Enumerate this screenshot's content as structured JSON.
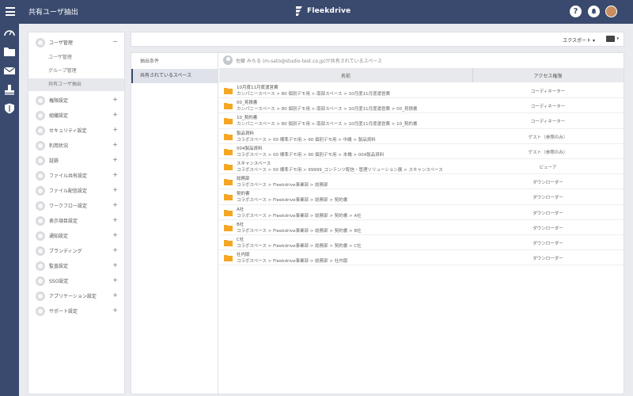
{
  "app": {
    "page_title": "共有ユーザ抽出",
    "brand_name": "Fleekdrive",
    "help_icon_label": "?"
  },
  "sidebar": {
    "items": [
      {
        "label": "ユーザ管理",
        "toggle": "−",
        "subitems": [
          {
            "label": "ユーザ管理"
          },
          {
            "label": "グループ管理"
          },
          {
            "label": "共有ユーザ抽出"
          }
        ]
      },
      {
        "label": "権限設定",
        "toggle": "+"
      },
      {
        "label": "組織設定",
        "toggle": "+"
      },
      {
        "label": "セキュリティ設定",
        "toggle": "+"
      },
      {
        "label": "利用状況",
        "toggle": "+"
      },
      {
        "label": "証跡",
        "toggle": "+"
      },
      {
        "label": "ファイル共有設定",
        "toggle": "+"
      },
      {
        "label": "ファイル配信設定",
        "toggle": "+"
      },
      {
        "label": "ワークフロー設定",
        "toggle": "+"
      },
      {
        "label": "表示項目設定",
        "toggle": "+"
      },
      {
        "label": "通知設定",
        "toggle": "+"
      },
      {
        "label": "ブランディング",
        "toggle": "+"
      },
      {
        "label": "監査設定",
        "toggle": "+"
      },
      {
        "label": "SSO設定",
        "toggle": "+"
      },
      {
        "label": "アプリケーション設定",
        "toggle": "+"
      },
      {
        "label": "サポート設定",
        "toggle": "+"
      }
    ]
  },
  "toolbar": {
    "export_label": "エクスポート ▾",
    "folder_menu_caret": "▾"
  },
  "conditions": {
    "items": [
      {
        "label": "抽出条件"
      },
      {
        "label": "共有されているスペース"
      }
    ]
  },
  "owner": {
    "text": "佐藤 みちる (m-sato@studio-test.co.jp)が共有されているスペース"
  },
  "table": {
    "headers": {
      "name": "名前",
      "access": "アクセス権限"
    },
    "rows": [
      {
        "name": "10月度11月度運営費",
        "path": "カンパニースペース > 80 個別デモ用 > 南部スペース > 10月度11月度運営費",
        "access": "コーディネーター"
      },
      {
        "name": "00_見積書",
        "path": "カンパニースペース > 80 個別デモ用 > 南部スペース > 10月度11月度運営費 > 00_見積書",
        "access": "コーディネーター"
      },
      {
        "name": "10_契約書",
        "path": "カンパニースペース > 80 個別デモ用 > 南部スペース > 10月度11月度運営費 > 10_契約書",
        "access": "コーディネーター"
      },
      {
        "name": "製品資料",
        "path": "コラボスペース > 00 標準デモ用 > 90 個別デモ用 > 中縄 > 製品資料",
        "access": "ゲスト（参照のみ）"
      },
      {
        "name": "004製品資料",
        "path": "コラボスペース > 00 標準デモ用 > 90 個別デモ用 > 本橋 > 004製品資料",
        "access": "ゲスト（参照のみ）"
      },
      {
        "name": "スキャンスペース",
        "path": "コラボスペース > 00 標準デモ用 > 99999_コンテンツ配信・管理ソリューション展 > スキャンスペース",
        "access": "ビューア"
      },
      {
        "name": "総務部",
        "path": "コラボスペース > Fleekdrive事業部 > 総務部",
        "access": "ダウンローダー"
      },
      {
        "name": "契約書",
        "path": "コラボスペース > Fleekdrive事業部 > 総務部 > 契約書",
        "access": "ダウンローダー"
      },
      {
        "name": "A社",
        "path": "コラボスペース > Fleekdrive事業部 > 総務部 > 契約書 > A社",
        "access": "ダウンローダー"
      },
      {
        "name": "B社",
        "path": "コラボスペース > Fleekdrive事業部 > 総務部 > 契約書 > B社",
        "access": "ダウンローダー"
      },
      {
        "name": "C社",
        "path": "コラボスペース > Fleekdrive事業部 > 総務部 > 契約書 > C社",
        "access": "ダウンローダー"
      },
      {
        "name": "社内版",
        "path": "コラボスペース > Fleekdrive事業部 > 総務部 > 社内版",
        "access": "ダウンローダー"
      }
    ]
  },
  "colors": {
    "header_bg": "#3a4a6e",
    "folder": "#f5a623",
    "active_bg": "#dfe2ea"
  }
}
